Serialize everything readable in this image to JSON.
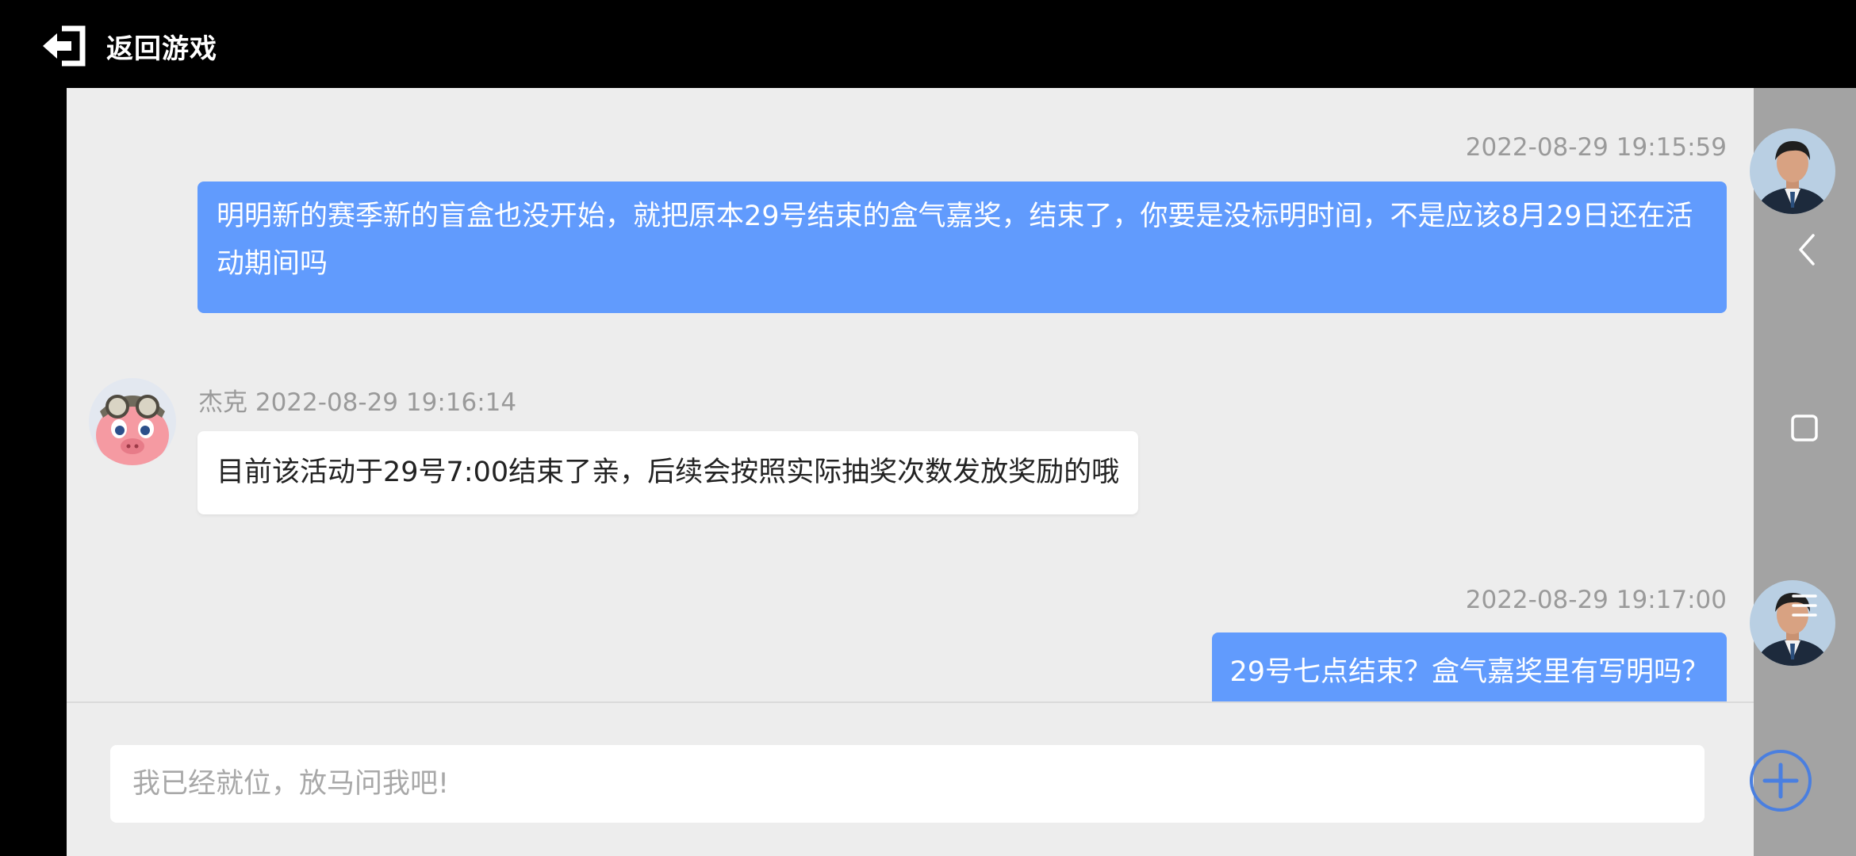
{
  "header": {
    "back_label": "返回游戏",
    "back_icon": "exit-arrow-icon"
  },
  "messages": [
    {
      "sender": "me",
      "timestamp": "2022-08-29 19:15:59",
      "text": "明明新的赛季新的盲盒也没开始，就把原本29号结束的盒气嘉奖，结束了，你要是没标明时间，不是应该8月29日还在活动期间吗"
    },
    {
      "sender": "agent",
      "sender_name": "杰克",
      "timestamp": "2022-08-29 19:16:14",
      "text": "目前该活动于29号7:00结束了亲，后续会按照实际抽奖次数发放奖励的哦"
    },
    {
      "sender": "me",
      "timestamp": "2022-08-29 19:17:00",
      "text": "29号七点结束？盒气嘉奖里有写明吗？"
    }
  ],
  "input": {
    "placeholder": "我已经就位，放马问我吧!"
  },
  "side_nav": {
    "icons": [
      "chevron-left-icon",
      "square-icon",
      "menu-icon"
    ]
  },
  "colors": {
    "my_bubble": "#619bfd",
    "agent_bubble": "#ffffff",
    "chat_background": "#ededed",
    "side_panel": "#a3a3a3",
    "add_button": "#4a7fe0"
  }
}
